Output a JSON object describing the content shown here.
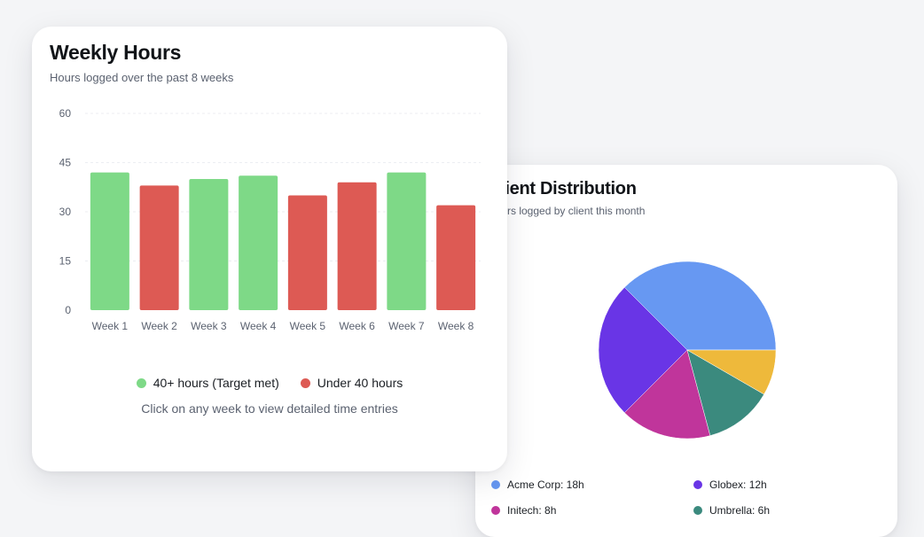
{
  "weekly_card": {
    "title": "Weekly Hours",
    "subtitle": "Hours logged over the past 8 weeks",
    "legend": [
      {
        "label": "40+ hours (Target met)",
        "color": "#7ed987"
      },
      {
        "label": "Under 40 hours",
        "color": "#dd5a54"
      }
    ],
    "hint": "Click on any week to view detailed time entries"
  },
  "client_card": {
    "title": "Client Distribution",
    "subtitle": "Hours logged by client this month",
    "legend": [
      {
        "label": "Acme Corp: 18h",
        "color": "#6798f2"
      },
      {
        "label": "Globex: 12h",
        "color": "#6935e6"
      },
      {
        "label": "Initech: 8h",
        "color": "#c0359b"
      },
      {
        "label": "Umbrella: 6h",
        "color": "#3b8a7e"
      }
    ]
  },
  "chart_data": [
    {
      "type": "bar",
      "categories": [
        "Week 1",
        "Week 2",
        "Week 3",
        "Week 4",
        "Week 5",
        "Week 6",
        "Week 7",
        "Week 8"
      ],
      "values": [
        42,
        38,
        40,
        41,
        35,
        39,
        42,
        32
      ],
      "ylim": [
        0,
        60
      ],
      "yticks": [
        0,
        15,
        30,
        45,
        60
      ],
      "target": 40,
      "colors": {
        "met": "#7ed987",
        "under": "#dd5a54"
      },
      "grid": true
    },
    {
      "type": "pie",
      "labels": [
        "Acme Corp",
        "Globex",
        "Initech",
        "Umbrella",
        ""
      ],
      "values": [
        18,
        12,
        8,
        6,
        4
      ],
      "colors": [
        "#6798f2",
        "#6935e6",
        "#c0359b",
        "#3b8a7e",
        "#eeb93b"
      ]
    }
  ]
}
